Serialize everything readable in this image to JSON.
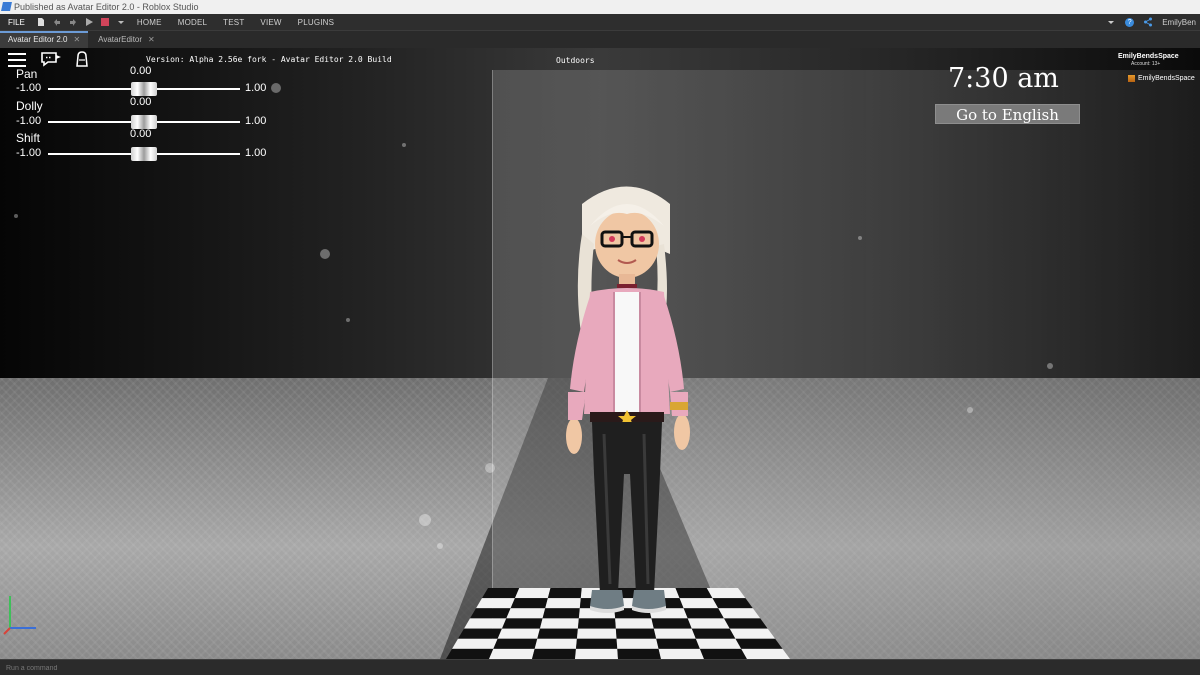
{
  "window": {
    "title": "Published as Avatar Editor 2.0 - Roblox Studio"
  },
  "ribbon": {
    "file_label": "FILE",
    "menus": [
      "HOME",
      "MODEL",
      "TEST",
      "VIEW",
      "PLUGINS"
    ],
    "user_label": "EmilyBen"
  },
  "tabs": [
    {
      "label": "Avatar Editor 2.0",
      "close": "✕",
      "active": true
    },
    {
      "label": "AvatarEditor",
      "close": "✕",
      "active": false
    }
  ],
  "game_ui": {
    "version_text": "Version: Alpha 2.56e fork - Avatar Editor 2.0 Build",
    "location_label": "Outdoors",
    "clock": "7:30 am",
    "language_button": "Go to English",
    "player": {
      "name": "EmilyBendsSpace",
      "account": "Account: 13+",
      "list_name": "EmilyBendsSpace"
    }
  },
  "sliders": [
    {
      "label": "Pan",
      "value": "0.00",
      "min": "-1.00",
      "max": "1.00",
      "fraction": 0.5
    },
    {
      "label": "Dolly",
      "value": "0.00",
      "min": "-1.00",
      "max": "1.00",
      "fraction": 0.5
    },
    {
      "label": "Shift",
      "value": "0.00",
      "min": "-1.00",
      "max": "1.00",
      "fraction": 0.5
    }
  ],
  "command_bar": {
    "placeholder": "Run a command"
  },
  "colors": {
    "accent": "#3a8bdc",
    "jacket": "#e8a9bd",
    "hair": "#f2ede4",
    "button_bg": "#7a7a7a"
  }
}
